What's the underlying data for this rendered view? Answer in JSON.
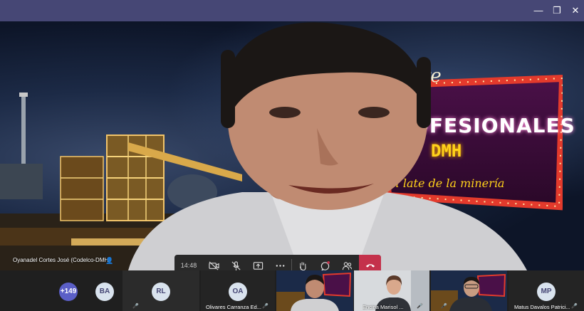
{
  "window": {
    "minimize": "—",
    "restore": "❐",
    "close": "✕"
  },
  "background": {
    "sign_line1": "al aire",
    "sign_line2": "PROFESIONALES",
    "sign_line3": "DMH",
    "sign_line4": "El late de la minería"
  },
  "speaker": {
    "name": "Oyanadel Cortes José (Codelco-DMH)"
  },
  "controls": {
    "timer": "14:48"
  },
  "gallery": {
    "overflow_count": "+149",
    "avatars": [
      {
        "initials": "BA",
        "color": "#d9e3ee"
      },
      {
        "initials": "RL",
        "color": "#d9e3ee"
      },
      {
        "initials": "OA",
        "color": "#d9e3ee"
      },
      {
        "initials": "MP",
        "color": "#d9e3ee"
      }
    ],
    "names": {
      "oa": "Olivares Carranza Ed...",
      "video2": "Encina Marisol ...",
      "mp": "Matus Davalos Patrici..."
    }
  },
  "colors": {
    "titlebar": "#464775",
    "leave": "#c4314b",
    "overflow_badge": "#5b5fc7"
  }
}
